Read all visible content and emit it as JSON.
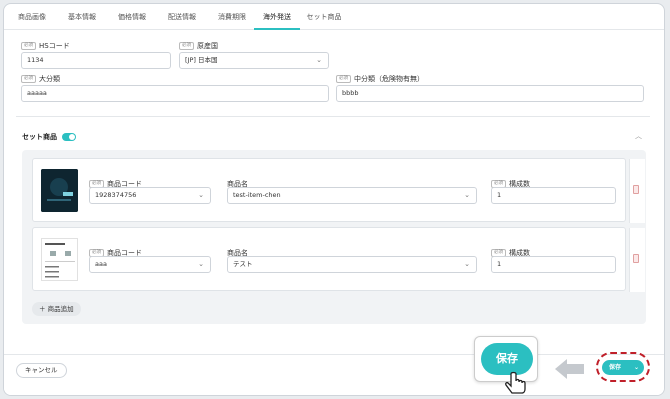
{
  "tabs": [
    "商品画像",
    "基本情報",
    "価格情報",
    "配送情報",
    "消費期限",
    "海外発送",
    "セット商品"
  ],
  "active_tab": "海外発送",
  "fields": {
    "hs_code": {
      "badge": "必須",
      "label": "HSコード",
      "value": "1134"
    },
    "origin": {
      "badge": "必須",
      "label": "原産国",
      "value": "[JP] 日本国"
    },
    "major_category": {
      "badge": "必須",
      "label": "大分類",
      "value": "aaaaa"
    },
    "middle_category": {
      "badge": "必須",
      "label": "中分類（危険物有無）",
      "value": "bbbb"
    }
  },
  "set_section": {
    "title": "セット商品",
    "toggle_on": true
  },
  "items": [
    {
      "code_badge": "必須",
      "code_label": "商品コード",
      "code_value": "1928374756",
      "name_label": "商品名",
      "name_value": "test-item-chen",
      "qty_badge": "必須",
      "qty_label": "構成数",
      "qty_value": "1"
    },
    {
      "code_badge": "必須",
      "code_label": "商品コード",
      "code_value": "aaa",
      "name_label": "商品名",
      "name_value": "テスト",
      "qty_badge": "必須",
      "qty_label": "構成数",
      "qty_value": "1"
    }
  ],
  "add_item_label": "＋ 商品追加",
  "footer": {
    "cancel_label": "キャンセル",
    "save_label": "保存",
    "small_save_label": "保存"
  },
  "colors": {
    "accent": "#2bbfc1",
    "highlight": "#c0202a"
  }
}
